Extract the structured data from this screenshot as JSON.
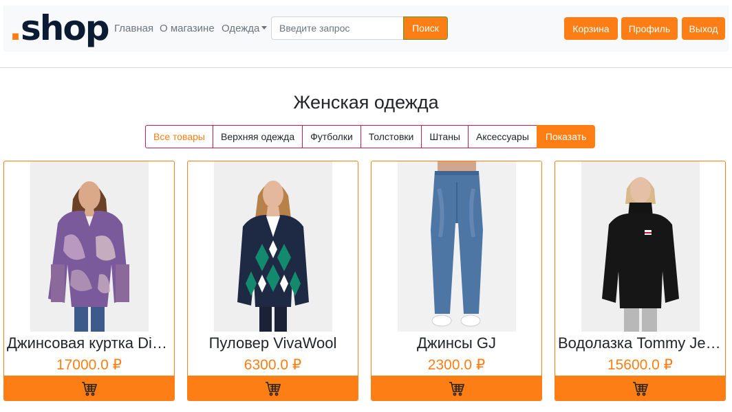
{
  "brand": {
    "dot": ".",
    "name": "shop"
  },
  "nav": {
    "home": "Главная",
    "about": "О магазине",
    "clothes": "Одежда"
  },
  "search": {
    "placeholder": "Введите запрос",
    "button": "Поиск"
  },
  "user_buttons": {
    "cart": "Корзина",
    "profile": "Профиль",
    "logout": "Выход"
  },
  "page": {
    "title": "Женская одежда"
  },
  "filters": {
    "items": [
      "Все товары",
      "Верхняя одежда",
      "Футболки",
      "Толстовки",
      "Штаны",
      "Аксессуары"
    ],
    "active": "Все товары",
    "apply": "Показать"
  },
  "products": [
    {
      "name": "Джинсовая куртка Dickies",
      "price": "17000.0 ₽"
    },
    {
      "name": "Пуловер VivaWool",
      "price": "6300.0 ₽"
    },
    {
      "name": "Джинсы GJ",
      "price": "2300.0 ₽"
    },
    {
      "name": "Водолазка Tommy Jeans",
      "price": "15600.0 ₽"
    }
  ],
  "colors": {
    "accent": "#fd7e14",
    "brand_dark": "#0b1b33",
    "filter_border": "#c9184a"
  }
}
